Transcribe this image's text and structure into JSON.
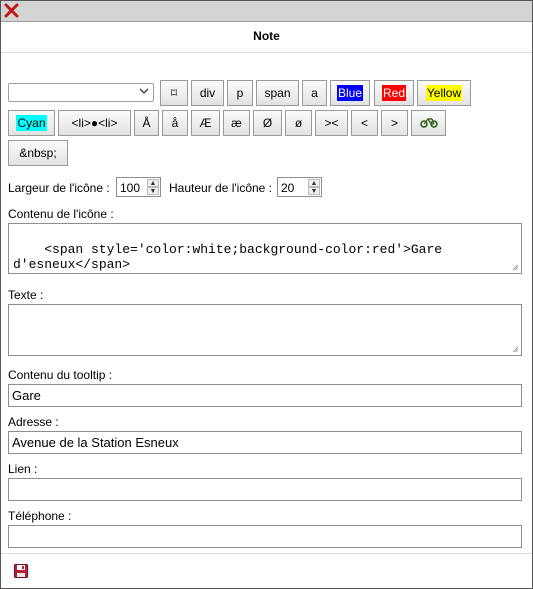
{
  "dialog": {
    "title": "Note"
  },
  "toolbar": {
    "select_value": "",
    "row1": [
      "⌑",
      "div",
      "p",
      "span",
      "a",
      "Blue",
      "Red",
      "Yellow"
    ],
    "row2": [
      "Cyan",
      "<li>●<li>",
      "Å",
      "å",
      "Æ",
      "æ",
      "Ø",
      "ø",
      "><",
      "<",
      ">"
    ],
    "row3": [
      "&nbsp;"
    ]
  },
  "size": {
    "width_label": "Largeur de l'icône :",
    "width_value": "100",
    "height_label": "Hauteur de l'icône :",
    "height_value": "20"
  },
  "fields": {
    "icon_content_label": "Contenu de l'icône :",
    "icon_content_value": "<span style='color:white;background-color:red'>Gare d'esneux</span>",
    "text_label": "Texte :",
    "text_value": "",
    "tooltip_label": "Contenu du tooltip :",
    "tooltip_value": "Gare",
    "address_label": "Adresse :",
    "address_value": "Avenue de la Station Esneux",
    "link_label": "Lien :",
    "link_value": "",
    "phone_label": "Téléphone :",
    "phone_value": ""
  },
  "icons": {
    "close": "close-icon",
    "bike": "bicycle-icon",
    "save": "save-icon"
  },
  "colors": {
    "blue": "#0000ff",
    "red": "#ff0000",
    "yellow": "#ffff00",
    "cyan": "#00ffff",
    "close_red": "#d11a1a"
  }
}
